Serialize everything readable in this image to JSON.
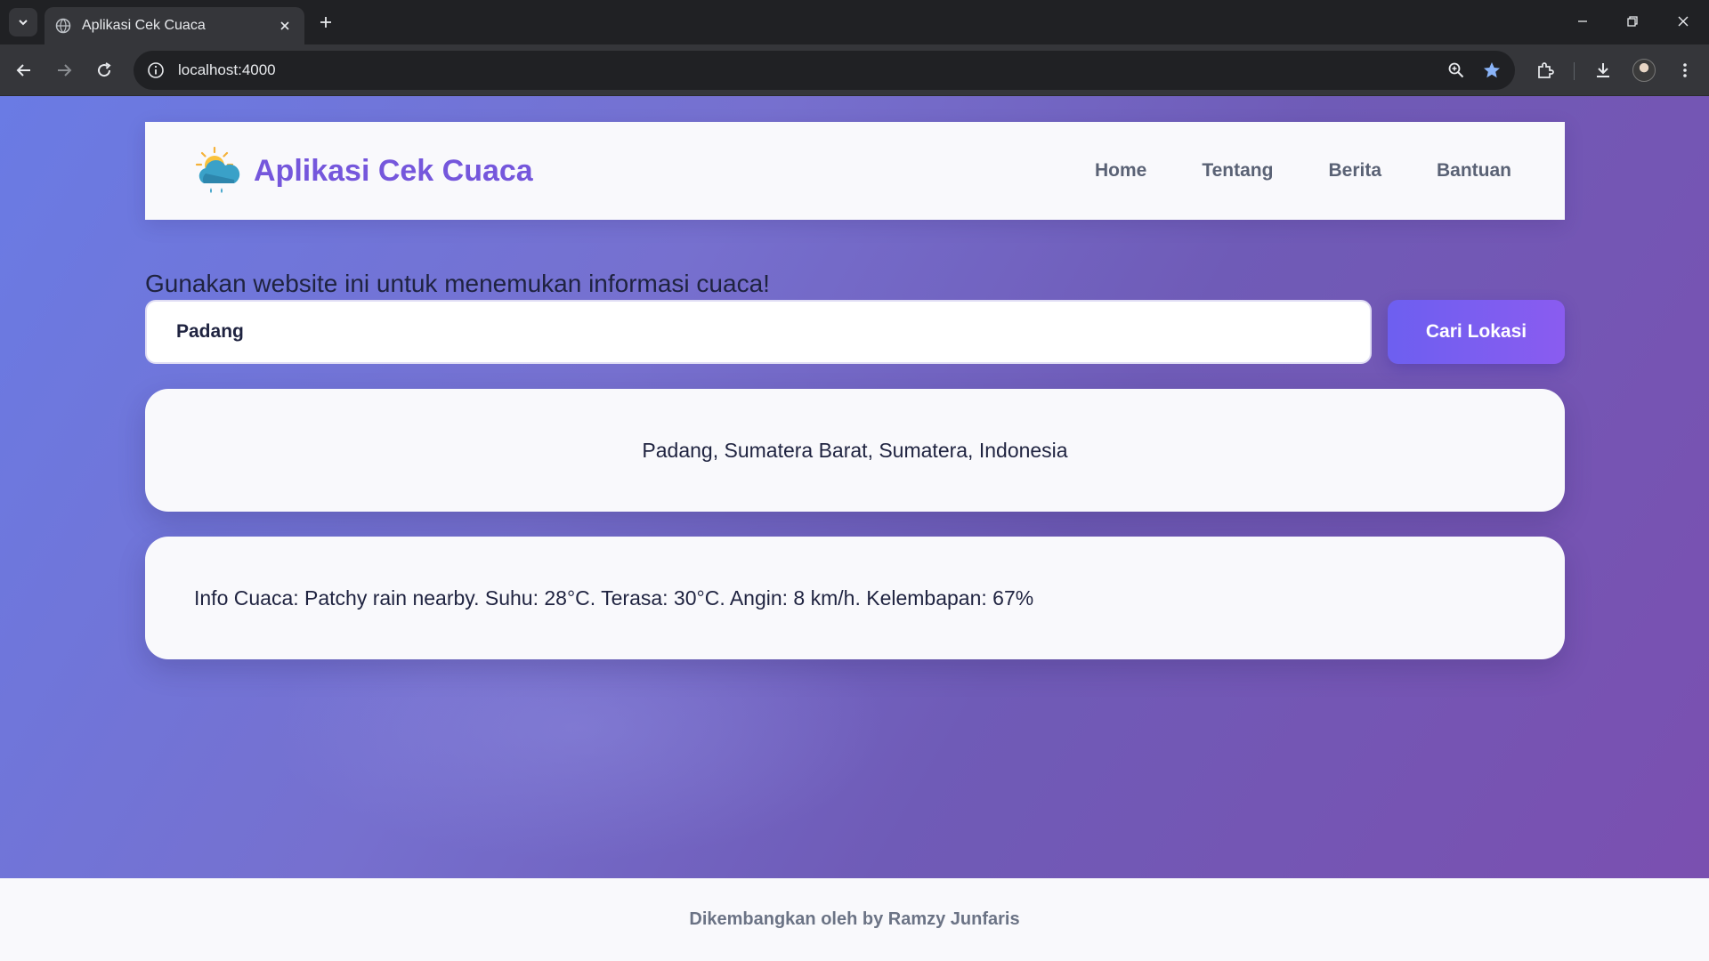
{
  "browser": {
    "tab_title": "Aplikasi Cek Cuaca",
    "url": "localhost:4000"
  },
  "header": {
    "brand": "Aplikasi Cek Cuaca",
    "logo_icon": "sun-cloud-rain-icon",
    "nav": [
      "Home",
      "Tentang",
      "Berita",
      "Bantuan"
    ]
  },
  "search": {
    "intro": "Gunakan website ini untuk menemukan informasi cuaca!",
    "value": "Padang",
    "button_label": "Cari Lokasi"
  },
  "results": {
    "location": "Padang, Sumatera Barat, Sumatera, Indonesia",
    "weather": "Info Cuaca: Patchy rain nearby. Suhu: 28°C. Terasa: 30°C. Angin: 8 km/h. Kelembapan: 67%"
  },
  "footer": {
    "credit": "Dikembangkan oleh by Ramzy Junfaris"
  },
  "colors": {
    "brand": "#7557dc",
    "button_start": "#6d5ff0",
    "button_end": "#8a5cf0",
    "background_start": "#6a7be4",
    "background_end": "#7b4fb0"
  }
}
